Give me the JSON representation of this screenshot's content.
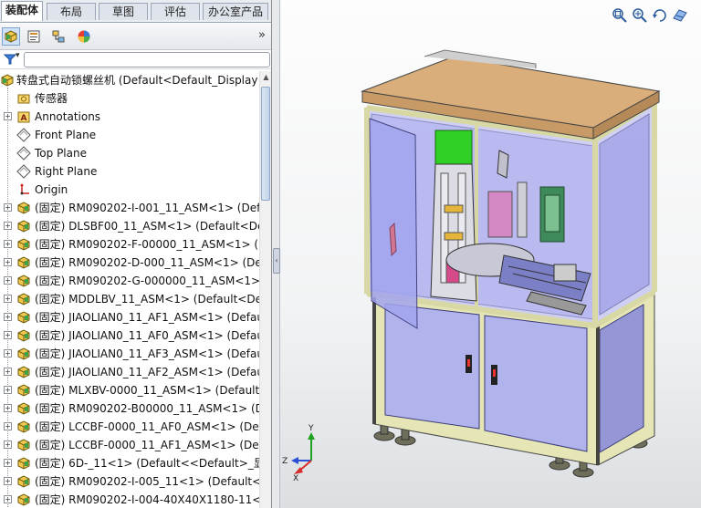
{
  "tabs": [
    {
      "label": "装配体",
      "active": true
    },
    {
      "label": "布局",
      "active": false
    },
    {
      "label": "草图",
      "active": false
    },
    {
      "label": "评估",
      "active": false
    },
    {
      "label": "办公室产品",
      "active": false
    }
  ],
  "panel_toolbar": {
    "icons": [
      "feature-manager-icon",
      "property-manager-icon",
      "configuration-manager-icon",
      "display-manager-icon"
    ],
    "expand_label": "»"
  },
  "filter": {
    "icon": "filter-icon",
    "dropdown": "▾",
    "value": ""
  },
  "tree": {
    "root": {
      "label": "转盘式自动锁螺丝机  (Default<Default_Display",
      "icon": "assembly-icon"
    },
    "items": [
      {
        "label": "传感器",
        "icon": "sensor-folder-icon",
        "expandable": false
      },
      {
        "label": "Annotations",
        "icon": "annotations-icon",
        "expandable": true
      },
      {
        "label": "Front Plane",
        "icon": "plane-icon",
        "expandable": false
      },
      {
        "label": "Top Plane",
        "icon": "plane-icon",
        "expandable": false
      },
      {
        "label": "Right Plane",
        "icon": "plane-icon",
        "expandable": false
      },
      {
        "label": "Origin",
        "icon": "origin-icon",
        "expandable": false
      },
      {
        "label": "(固定) RM090202-I-001_11_ASM<1> (Defau",
        "icon": "subassembly-icon",
        "expandable": true
      },
      {
        "label": "(固定) DLSBF00_11_ASM<1> (Default<Def",
        "icon": "subassembly-icon",
        "expandable": true
      },
      {
        "label": "(固定) RM090202-F-00000_11_ASM<1> (De",
        "icon": "subassembly-icon",
        "expandable": true
      },
      {
        "label": "(固定) RM090202-D-000_11_ASM<1> (Defa",
        "icon": "subassembly-icon",
        "expandable": true
      },
      {
        "label": "(固定) RM090202-G-000000_11_ASM<1> (",
        "icon": "subassembly-icon",
        "expandable": true
      },
      {
        "label": "(固定) MDDLBV_11_ASM<1> (Default<Def",
        "icon": "subassembly-icon",
        "expandable": true
      },
      {
        "label": "(固定) JIAOLIAN0_11_AF1_ASM<1> (Defaul",
        "icon": "subassembly-icon",
        "expandable": true
      },
      {
        "label": "(固定) JIAOLIAN0_11_AF0_ASM<1> (Defaul",
        "icon": "subassembly-icon",
        "expandable": true
      },
      {
        "label": "(固定) JIAOLIAN0_11_AF3_ASM<1> (Defaul",
        "icon": "subassembly-icon",
        "expandable": true
      },
      {
        "label": "(固定) JIAOLIAN0_11_AF2_ASM<1> (Defaul",
        "icon": "subassembly-icon",
        "expandable": true
      },
      {
        "label": "(固定) MLXBV-0000_11_ASM<1> (Default<",
        "icon": "subassembly-icon",
        "expandable": true
      },
      {
        "label": "(固定) RM090202-B00000_11_ASM<1> (De",
        "icon": "subassembly-icon",
        "expandable": true
      },
      {
        "label": "(固定) LCCBF-0000_11_AF0_ASM<1> (Defa",
        "icon": "subassembly-icon",
        "expandable": true
      },
      {
        "label": "(固定) LCCBF-0000_11_AF1_ASM<1> (Defa",
        "icon": "subassembly-icon",
        "expandable": true
      },
      {
        "label": "(固定) 6D-_11<1> (Default<<Default>_显示",
        "icon": "subassembly-icon",
        "expandable": true
      },
      {
        "label": "(固定) RM090202-I-005_11<1> (Default<<",
        "icon": "subassembly-icon",
        "expandable": true
      },
      {
        "label": "(固定) RM090202-I-004-40X40X1180-11<1",
        "icon": "subassembly-icon",
        "expandable": true
      }
    ]
  },
  "viewport": {
    "view_tools": [
      "zoom-to-fit-icon",
      "zoom-to-area-icon",
      "previous-view-icon",
      "section-view-icon"
    ],
    "triad": {
      "x": "X",
      "y": "Y",
      "z": "Z"
    },
    "colors": {
      "frame": "#e3e3b0",
      "panel": "#9a9be0",
      "top": "#d9ae7a"
    }
  }
}
